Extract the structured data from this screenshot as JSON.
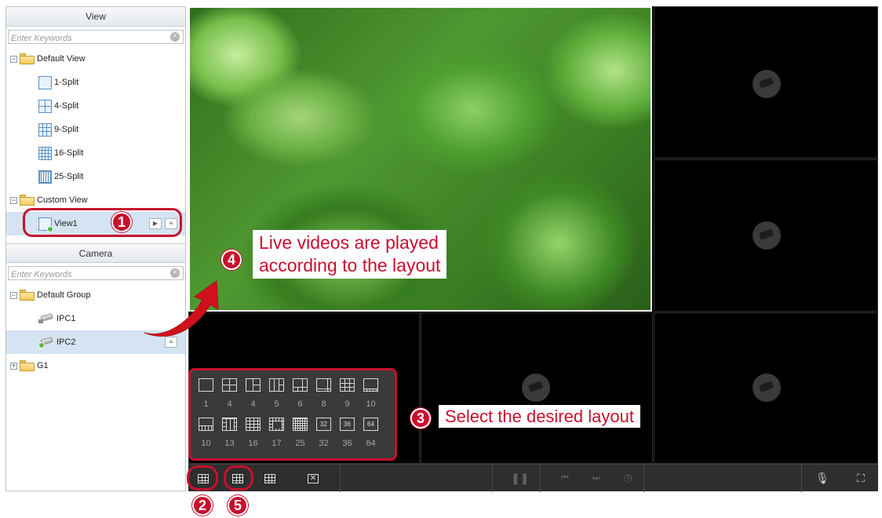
{
  "view_panel": {
    "title": "View",
    "search_placeholder": "Enter Keywords",
    "default_view_label": "Default View",
    "splits": [
      "1-Split",
      "4-Split",
      "9-Split",
      "16-Split",
      "25-Split"
    ],
    "custom_view_label": "Custom View",
    "view1_label": "View1"
  },
  "camera_panel": {
    "title": "Camera",
    "search_placeholder": "Enter Keywords",
    "default_group_label": "Default Group",
    "cameras": [
      "IPC1",
      "IPC2"
    ],
    "group_g1_label": "G1"
  },
  "layout_popup": {
    "row1_numbers": [
      "1",
      "4",
      "4",
      "5",
      "6",
      "8",
      "9",
      "10"
    ],
    "row2_numbers": [
      "10",
      "13",
      "16",
      "17",
      "25",
      "32",
      "36",
      "64"
    ],
    "row2_box_labels": [
      "",
      "",
      "",
      "",
      "",
      "32",
      "36",
      "64"
    ]
  },
  "annotations": {
    "badge1": "1",
    "badge2": "2",
    "badge3": "3",
    "badge4": "4",
    "badge5": "5",
    "callout_live": "Live videos are played according to the layout",
    "callout_live_line1": "Live videos are played",
    "callout_live_line2": "according to the layout",
    "callout_select": "Select the desired layout"
  },
  "colors": {
    "annotation_red": "#c8102e",
    "video_bg": "#000000",
    "toolbar_bg": "#2e2e2e",
    "selection_bg": "#d4e4f3"
  }
}
